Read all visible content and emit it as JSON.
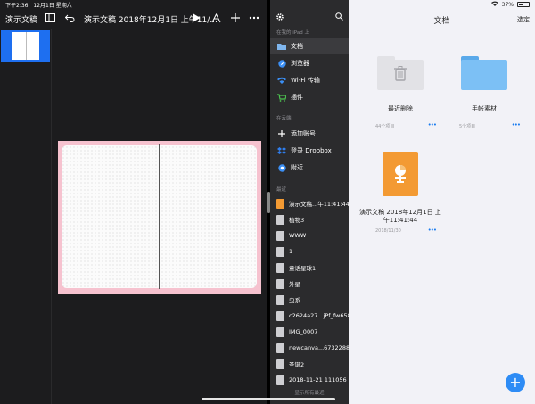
{
  "status_bar": {
    "time": "下午2:36",
    "date": "12月1日 星期六",
    "battery": "37%"
  },
  "keynote": {
    "toolbar": {
      "back_label": "演示文稿",
      "document_title": "演示文稿 2018年12月1日 上午11/..."
    }
  },
  "files_sidebar": {
    "section_ipad": "在我的 iPad 上",
    "section_cloud": "在云端",
    "section_recent": "最近",
    "items": [
      {
        "label": "文档"
      },
      {
        "label": "浏览器"
      },
      {
        "label": "Wi-Fi 传输"
      },
      {
        "label": "插件"
      }
    ],
    "cloud_items": [
      {
        "label": "添加账号"
      },
      {
        "label": "登录 Dropbox"
      },
      {
        "label": "附近"
      }
    ],
    "recent_items": [
      {
        "label": "演示文稿...午11:41:44"
      },
      {
        "label": "植物3"
      },
      {
        "label": "WWW"
      },
      {
        "label": "1"
      },
      {
        "label": "童话星球1"
      },
      {
        "label": "外星"
      },
      {
        "label": "虫系"
      },
      {
        "label": "c2624a27...jPf_fw658"
      },
      {
        "label": "IMG_0007"
      },
      {
        "label": "newcanva...67322889"
      },
      {
        "label": "圣诞2"
      },
      {
        "label": "2018-11-21 111056"
      }
    ],
    "show_all": "显示所有最近"
  },
  "files_main": {
    "title": "文档",
    "select_label": "选定",
    "items": [
      {
        "name": "最近删除",
        "meta": "44个项目",
        "more": "•••"
      },
      {
        "name": "手帐素材",
        "meta": "5个项目",
        "more": "•••"
      },
      {
        "name": "演示文稿 2018年12月1日 上午11:41:44",
        "meta": "2018/11/30",
        "more": "•••"
      }
    ]
  },
  "colors": {
    "accent": "#2e8cf5",
    "slide_background": "#f6c2cf",
    "keynote_orange": "#f39a33",
    "sidebar_dark": "#2b2b2d"
  }
}
